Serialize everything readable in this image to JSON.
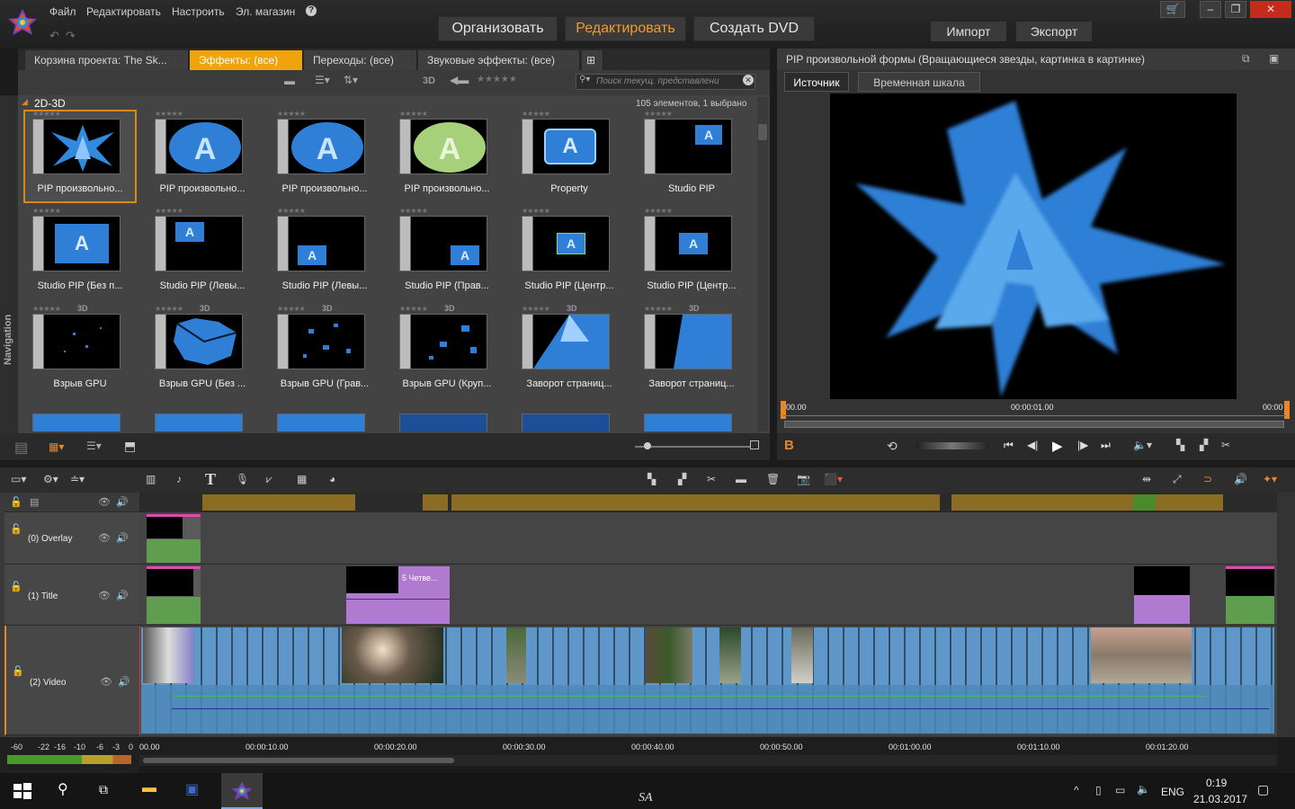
{
  "menu": {
    "file": "Файл",
    "edit": "Редактировать",
    "settings": "Настроить",
    "store": "Эл. магазин",
    "help": "?"
  },
  "modes": {
    "organize": "Организовать",
    "edit": "Редактировать",
    "dvd": "Создать DVD"
  },
  "io": {
    "import": "Импорт",
    "export": "Экспорт"
  },
  "library": {
    "tabs": [
      "Корзина проекта: The Sk...",
      "Эффекты: (все)",
      "Переходы: (все)",
      "Звуковые эффекты: (все)"
    ],
    "search_placeholder": "Поиск текущ. представлени",
    "category": "2D-3D",
    "count": "105 элементов, 1 выбрано",
    "nav_label": "Navigation",
    "tool_3d": "3D",
    "items_row1": [
      "PIP произвольно...",
      "PIP произвольно...",
      "PIP произвольно...",
      "PIP произвольно...",
      "Property",
      "Studio PIP"
    ],
    "items_row2": [
      "Studio PIP (Без п...",
      "Studio PIP (Левы...",
      "Studio PIP (Левы...",
      "Studio PIP (Прав...",
      "Studio PIP (Центр...",
      "Studio PIP (Центр..."
    ],
    "items_row3": [
      "Взрыв GPU",
      "Взрыв GPU (Без ...",
      "Взрыв GPU (Грав...",
      "Взрыв GPU (Круп...",
      "Заворот страниц...",
      "Заворот страниц..."
    ]
  },
  "preview": {
    "title": "PIP произвольной формы (Вращающиеся звезды, картинка в картинке)",
    "tab_source": "Источник",
    "tab_timeline": "Временная шкала",
    "time_start": "00.00",
    "time_mid": "00:00:01.00",
    "time_end": "00:00",
    "marker": "B"
  },
  "tracks": [
    {
      "name": "(0) Overlay"
    },
    {
      "name": "(1) Title"
    },
    {
      "name": "(2) Video"
    }
  ],
  "title_clip": "5 Четве...",
  "ruler": [
    "00.00",
    "00:00:10.00",
    "00:00:20.00",
    "00:00:30.00",
    "00:00:40.00",
    "00:00:50.00",
    "00:01:00.00",
    "00:01:10.00",
    "00:01:20.00"
  ],
  "meter": [
    "-60",
    "-22",
    "-16",
    "-10",
    "-6",
    "-3",
    "0"
  ],
  "taskbar": {
    "lang": "ENG",
    "time": "0:19",
    "date": "21.03.2017",
    "sa": "SA"
  }
}
